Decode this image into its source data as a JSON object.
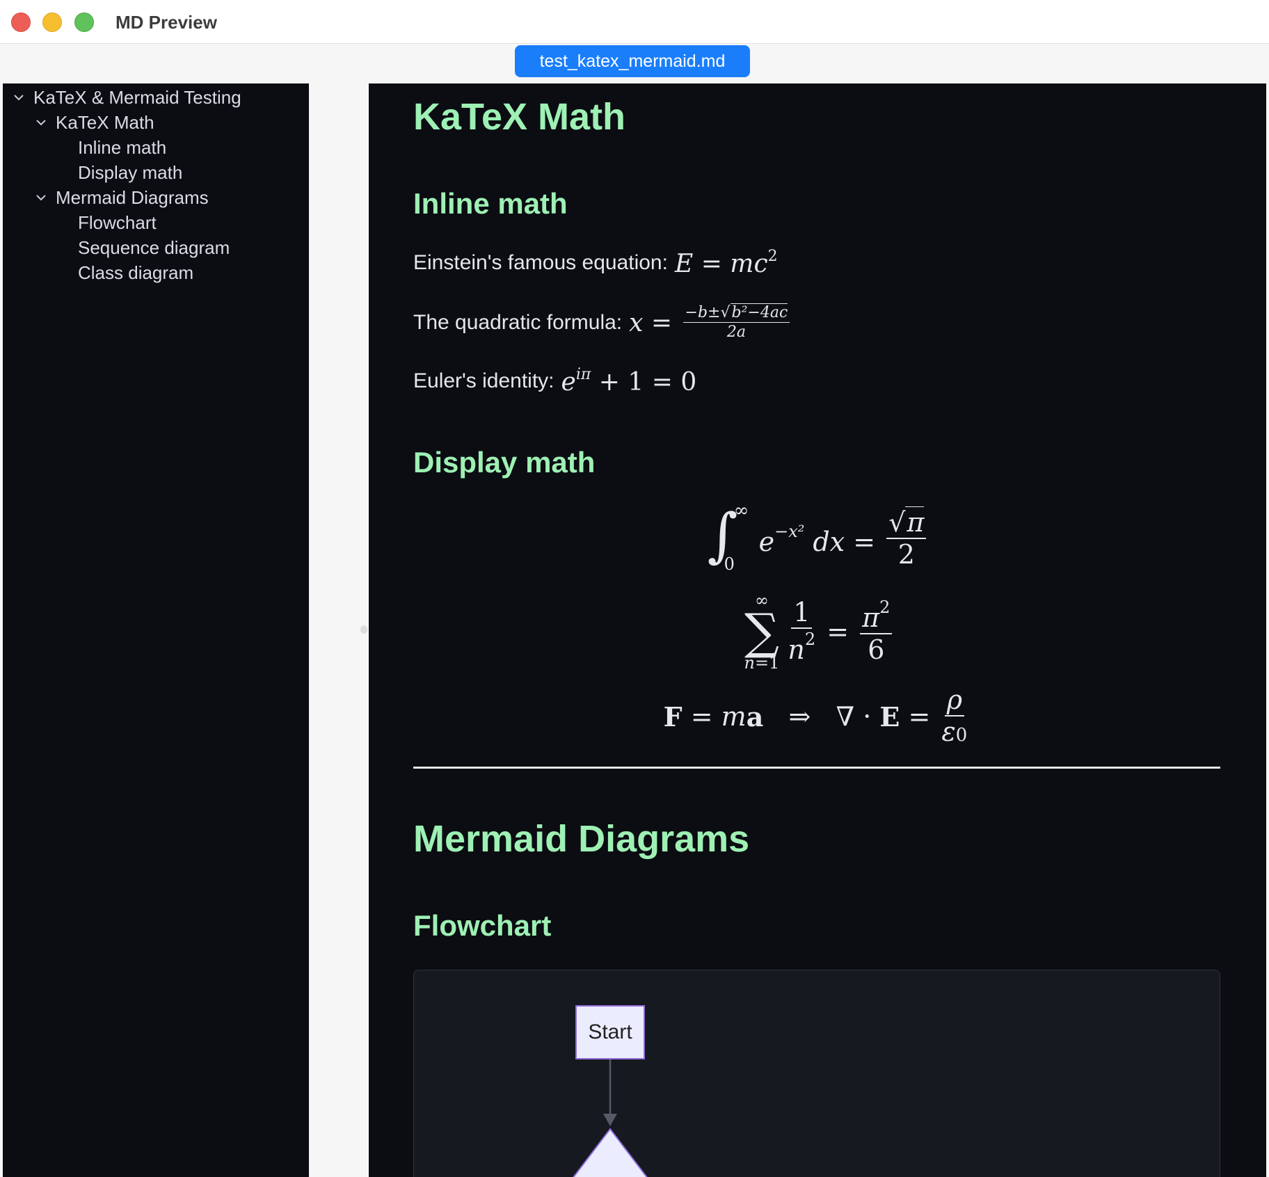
{
  "window": {
    "title": "MD Preview"
  },
  "tab": {
    "label": "test_katex_mermaid.md"
  },
  "toc": {
    "root": "KaTeX & Mermaid Testing",
    "sections": [
      {
        "label": "KaTeX Math",
        "children": [
          "Inline math",
          "Display math"
        ]
      },
      {
        "label": "Mermaid Diagrams",
        "children": [
          "Flowchart",
          "Sequence diagram",
          "Class diagram"
        ]
      }
    ]
  },
  "content": {
    "katex_heading": "KaTeX Math",
    "inline_heading": "Inline math",
    "einstein_label": "Einstein's famous equation:",
    "quadratic_label": "The quadratic formula:",
    "euler_label": "Euler's identity:",
    "display_heading": "Display math",
    "mermaid_heading": "Mermaid Diagrams",
    "flowchart_heading": "Flowchart",
    "flowchart_start": "Start"
  },
  "colors": {
    "heading": "#9ef0b4",
    "tab_accent": "#1a7efb",
    "panel_bg": "#0b0d12",
    "node_fill": "#ececff",
    "node_stroke": "#9370db"
  }
}
